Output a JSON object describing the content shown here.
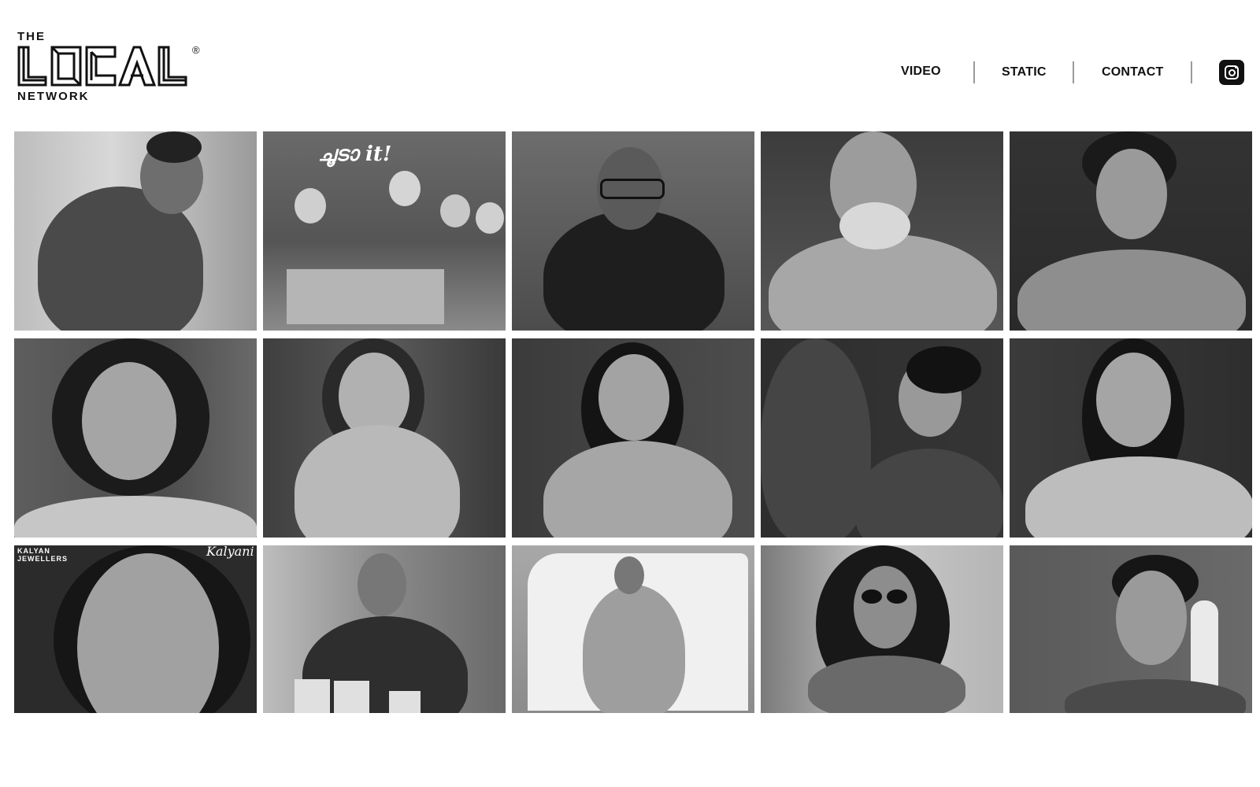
{
  "logo": {
    "top_text": "THE",
    "main_text": "LOCAL",
    "bottom_text": "NETWORK",
    "registered_mark": "®"
  },
  "nav": {
    "items": [
      {
        "label": "VIDEO"
      },
      {
        "label": "STATIC"
      },
      {
        "label": "CONTACT"
      }
    ],
    "instagram_icon": "instagram-icon"
  },
  "gallery": {
    "tiles": [
      {
        "overlay": "",
        "mark": ""
      },
      {
        "overlay": "ചൂടാ it!",
        "mark": ""
      },
      {
        "overlay": "",
        "mark": ""
      },
      {
        "overlay": "",
        "mark": ""
      },
      {
        "overlay": "",
        "mark": ""
      },
      {
        "overlay": "",
        "mark": ""
      },
      {
        "overlay": "",
        "mark": ""
      },
      {
        "overlay": "",
        "mark": ""
      },
      {
        "overlay": "",
        "mark": ""
      },
      {
        "overlay": "",
        "mark": ""
      },
      {
        "overlay": "Kalyani",
        "mark": "KALYAN JEWELLERS"
      },
      {
        "overlay": "",
        "mark": ""
      },
      {
        "overlay": "",
        "mark": ""
      },
      {
        "overlay": "",
        "mark": ""
      },
      {
        "overlay": "",
        "mark": ""
      }
    ]
  }
}
